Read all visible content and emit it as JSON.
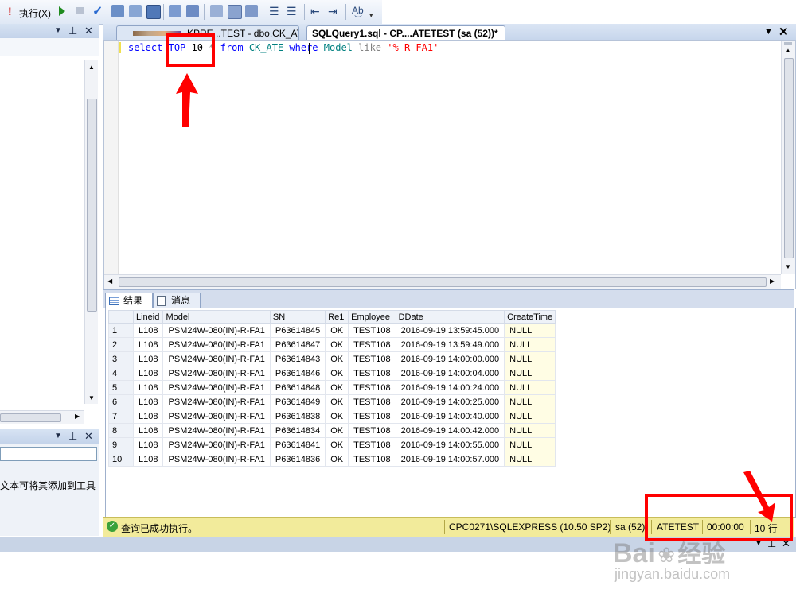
{
  "toolbar": {
    "execute_label": "执行(X)",
    "colors": {
      "execute_icon": "#d01c1c",
      "play_icon": "#1f8b1f",
      "check_icon": "#2a6bd1"
    }
  },
  "doc_tabs": [
    {
      "label": "KPRE...TEST - dbo.CK_ATE",
      "active": false
    },
    {
      "label": "SQLQuery1.sql - CP....ATETEST (sa (52))*",
      "active": true
    }
  ],
  "editor": {
    "tokens": {
      "select": "select",
      "top": "TOP",
      "ten": "10",
      "star": "*",
      "from": "from",
      "table": "CK_ATE",
      "where": "where",
      "column": "Model",
      "like": "like",
      "value": "'%-R-FA1'"
    }
  },
  "results_tabs": [
    {
      "label": "结果",
      "icon": "grid-icon"
    },
    {
      "label": "消息",
      "icon": "message-icon"
    }
  ],
  "grid": {
    "columns": [
      "Lineid",
      "Model",
      "SN",
      "Re1",
      "Employee",
      "DDate",
      "CreateTime"
    ],
    "rows": [
      [
        "1",
        "L108",
        "PSM24W-080(IN)-R-FA1",
        "P63614845",
        "OK",
        "TEST108",
        "2016-09-19 13:59:45.000",
        "NULL"
      ],
      [
        "2",
        "L108",
        "PSM24W-080(IN)-R-FA1",
        "P63614847",
        "OK",
        "TEST108",
        "2016-09-19 13:59:49.000",
        "NULL"
      ],
      [
        "3",
        "L108",
        "PSM24W-080(IN)-R-FA1",
        "P63614843",
        "OK",
        "TEST108",
        "2016-09-19 14:00:00.000",
        "NULL"
      ],
      [
        "4",
        "L108",
        "PSM24W-080(IN)-R-FA1",
        "P63614846",
        "OK",
        "TEST108",
        "2016-09-19 14:00:04.000",
        "NULL"
      ],
      [
        "5",
        "L108",
        "PSM24W-080(IN)-R-FA1",
        "P63614848",
        "OK",
        "TEST108",
        "2016-09-19 14:00:24.000",
        "NULL"
      ],
      [
        "6",
        "L108",
        "PSM24W-080(IN)-R-FA1",
        "P63614849",
        "OK",
        "TEST108",
        "2016-09-19 14:00:25.000",
        "NULL"
      ],
      [
        "7",
        "L108",
        "PSM24W-080(IN)-R-FA1",
        "P63614838",
        "OK",
        "TEST108",
        "2016-09-19 14:00:40.000",
        "NULL"
      ],
      [
        "8",
        "L108",
        "PSM24W-080(IN)-R-FA1",
        "P63614834",
        "OK",
        "TEST108",
        "2016-09-19 14:00:42.000",
        "NULL"
      ],
      [
        "9",
        "L108",
        "PSM24W-080(IN)-R-FA1",
        "P63614841",
        "OK",
        "TEST108",
        "2016-09-19 14:00:55.000",
        "NULL"
      ],
      [
        "10",
        "L108",
        "PSM24W-080(IN)-R-FA1",
        "P63614836",
        "OK",
        "TEST108",
        "2016-09-19 14:00:57.000",
        "NULL"
      ]
    ]
  },
  "status": {
    "message": "查询已成功执行。",
    "server": "CPC0271\\SQLEXPRESS (10.50 SP2)",
    "user": "sa (52)",
    "database": "ATETEST",
    "elapsed": "00:00:00",
    "rows": "10 行"
  },
  "left_panel": {
    "hint_text": "文本可将其添加到工具"
  },
  "watermark": {
    "brand": "Bai",
    "brand2": "经验",
    "url": "jingyan.baidu.com"
  }
}
